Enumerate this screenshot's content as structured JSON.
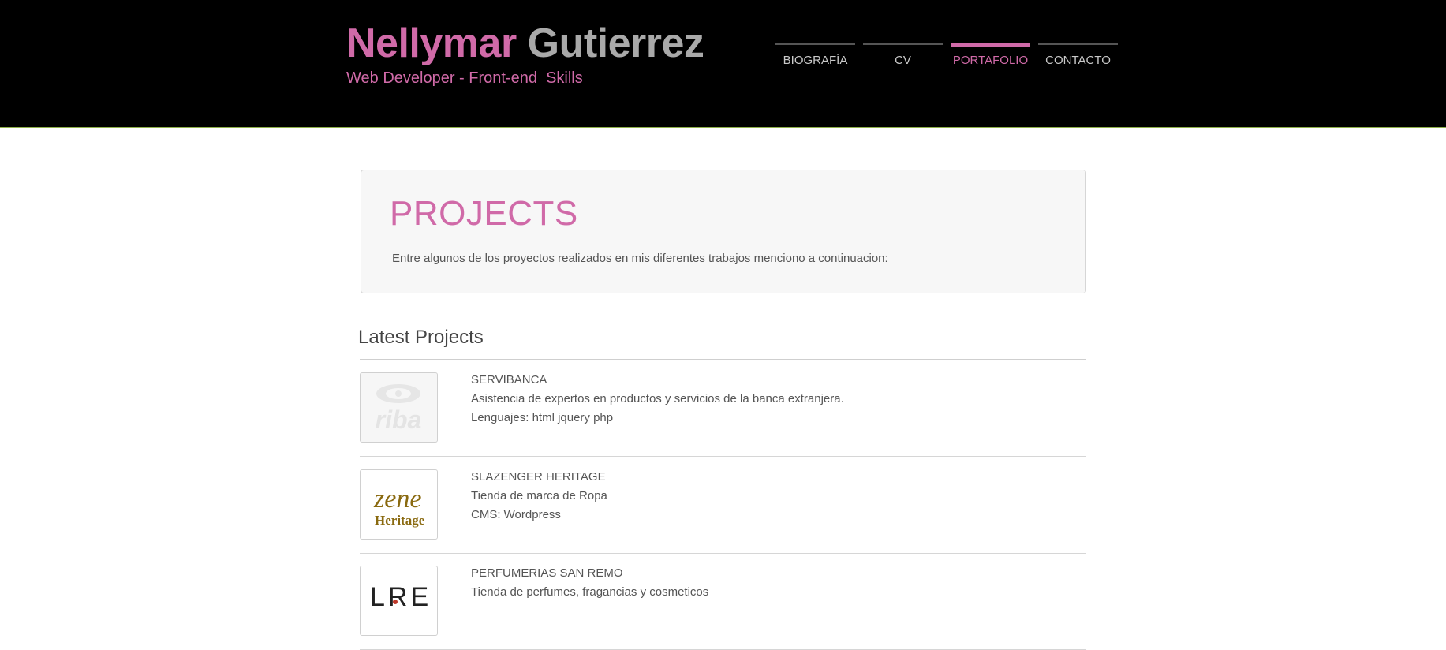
{
  "header": {
    "first_name": "Nellymar",
    "last_name": "Gutierrez",
    "subtitle": "Web Developer - Front-end  Skills",
    "nav": [
      {
        "label": "BIOGRAFÍA",
        "active": false
      },
      {
        "label": "CV",
        "active": false
      },
      {
        "label": "PORTAFOLIO",
        "active": true
      },
      {
        "label": "CONTACTO",
        "active": false
      }
    ]
  },
  "hero": {
    "title": "PROJECTS",
    "text": "Entre algunos de los proyectos realizados en mis diferentes trabajos menciono a continuacion:"
  },
  "section": {
    "title": "Latest Projects"
  },
  "projects": [
    {
      "name": "SERVIBANCA",
      "description": "Asistencia de expertos en productos y servicios de la banca extranjera.",
      "tech": "Lenguajes: html jquery php",
      "logo_text": "riba"
    },
    {
      "name": "SLAZENGER HERITAGE",
      "description": "Tienda de marca de Ropa",
      "tech": "CMS: Wordpress",
      "logo_text": "zene",
      "logo_text2": "Heritage"
    },
    {
      "name": "PERFUMERIAS SAN REMO",
      "description": "Tienda de perfumes, fragancias y cosmeticos",
      "tech": "",
      "logo_text": "LRE"
    }
  ],
  "colors": {
    "accent": "#d06aa8",
    "header_bg": "#000000",
    "header_rule": "#8fb04a"
  }
}
